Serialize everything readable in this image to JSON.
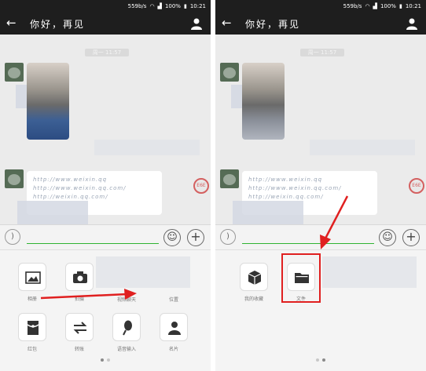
{
  "status_bar": {
    "speed": "559b/s",
    "battery": "100%",
    "time": "10:21"
  },
  "chat": {
    "title": "你好，再见",
    "timestamp": "周一 11:57"
  },
  "messages": {
    "link_line_1": "http://www.weixin.qq",
    "link_line_2": "http://www.weixin.qq.com/",
    "link_line_3": "http://weixin.qq.com/"
  },
  "badge_text": "E6E",
  "tools_left": [
    {
      "label": "相册",
      "icon": "image-icon"
    },
    {
      "label": "拍摄",
      "icon": "camera-icon"
    },
    {
      "label": "视频聊天",
      "icon": "video-icon"
    },
    {
      "label": "位置",
      "icon": "location-icon"
    },
    {
      "label": "红包",
      "icon": "red-packet-icon"
    },
    {
      "label": "转账",
      "icon": "transfer-icon"
    },
    {
      "label": "语音输入",
      "icon": "microphone-icon"
    },
    {
      "label": "名片",
      "icon": "contact-card-icon"
    }
  ],
  "tools_right": [
    {
      "label": "我的收藏",
      "icon": "cube-icon"
    },
    {
      "label": "文件",
      "icon": "folder-icon"
    }
  ],
  "colors": {
    "header": "#1e1e1e",
    "accent_green": "#2fb332",
    "annotation_red": "#e02020"
  }
}
